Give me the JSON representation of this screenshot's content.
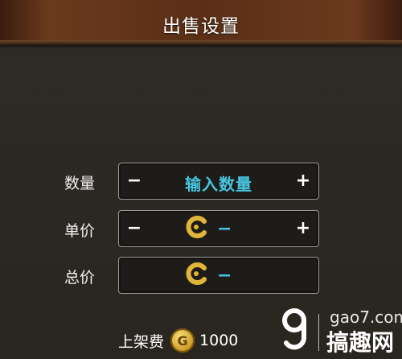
{
  "title": "出售设置",
  "rows": [
    {
      "label": "数量",
      "minus": "−",
      "plus": "+",
      "value": "输入数量"
    },
    {
      "label": "单价",
      "minus": "−",
      "plus": "+",
      "value": "−"
    },
    {
      "label": "总价",
      "value": "−"
    }
  ],
  "fee": {
    "label": "上架费",
    "amount": "1000"
  },
  "watermark": {
    "domain": "gao7.com",
    "name": "搞趣网"
  },
  "colors": {
    "accent": "#48c6e0",
    "title_bar": "#5a2f16",
    "coin": "#e0b53a"
  },
  "icons": {
    "coin": "gold-coin-icon",
    "fee_coin": "fee-coin-icon",
    "logo": "gao7-logo-icon"
  }
}
